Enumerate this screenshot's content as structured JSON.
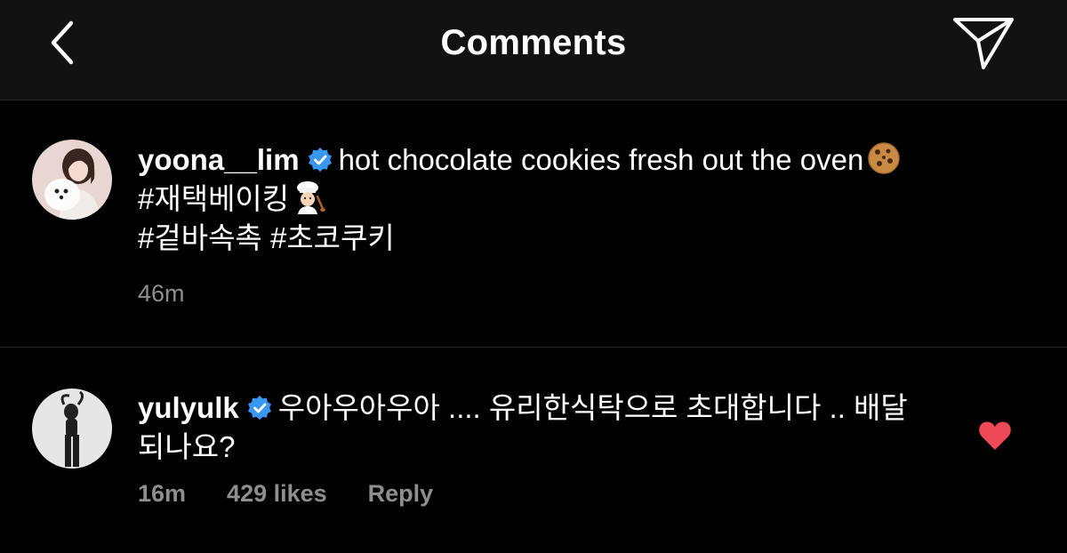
{
  "header": {
    "title": "Comments",
    "back_icon": "chevron-left-icon",
    "send_icon": "paper-plane-icon"
  },
  "post": {
    "username": "yoona__lim",
    "caption": "hot chocolate cookies fresh out the oven",
    "hashtag_line1": "#재택베이킹",
    "hashtag_line2": "#겉바속촉 #초코쿠키",
    "time": "46m",
    "emojis": [
      "cookie-emoji",
      "chef-emoji"
    ]
  },
  "comment": {
    "username": "yulyulk",
    "text": "우아우아우아 .... 유리한식탁으로 초대합니다 .. 배달 되나요?",
    "time": "16m",
    "likes": "429 likes",
    "reply_label": "Reply",
    "liked": true
  },
  "colors": {
    "background": "#000000",
    "header": "#121212",
    "verified": "#3897F0",
    "muted": "#8E8E8E",
    "heart": "#ED4956"
  }
}
